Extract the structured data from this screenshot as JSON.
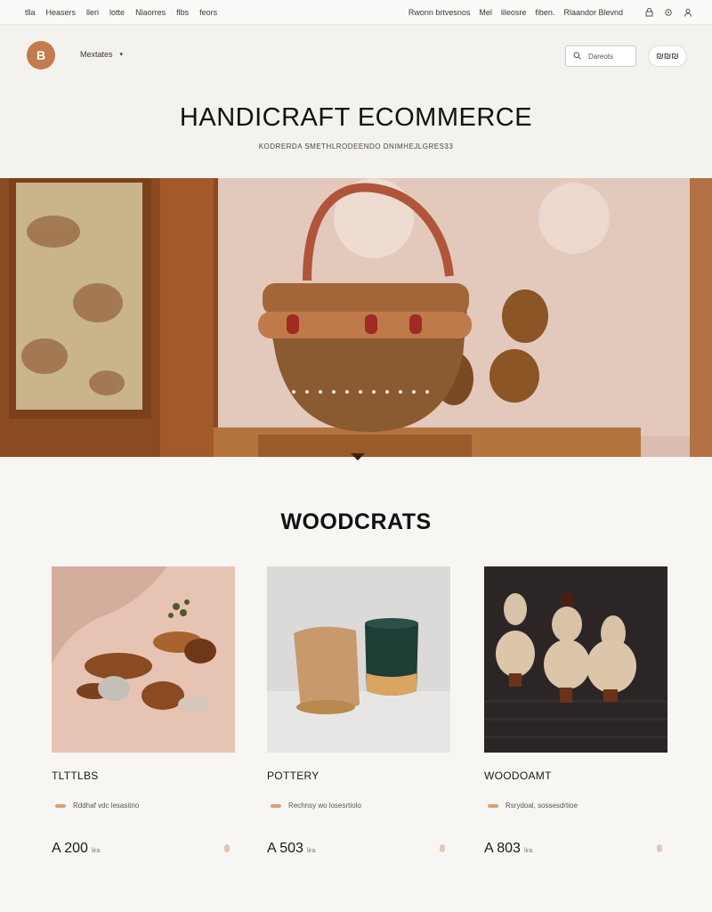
{
  "topbar": {
    "left_links": [
      "tlla",
      "Heasers",
      "lleri",
      "lotte",
      "Nlaorres",
      "flbs",
      "feors"
    ],
    "right_links": [
      "Rwonn brtvesnos",
      "Mel",
      "lileosre",
      "fiben.",
      "Rlaandor Blevnd"
    ],
    "icons": [
      "lock-icon",
      "settings-icon",
      "user-icon"
    ]
  },
  "header": {
    "logo_text": "B",
    "menu_label": "Mextates",
    "search_placeholder": "Dareots",
    "cart_label": "₪₪₪",
    "title": "HANDICRAFT ECOMMERCE",
    "subtitle": "KODRERDA SMETHLRODEENDO DNIMHEJLGRES33"
  },
  "hero": {
    "image_label": "handwoven basket on wooden stand"
  },
  "section": {
    "title": "WOODCRATS"
  },
  "products": [
    {
      "name": "TLTTLBS",
      "desc": "Rddhaf vdc lesasitrio",
      "price": "A 200",
      "unit": "lira"
    },
    {
      "name": "POTTERY",
      "desc": "Rechnsy wo losesrtiolo",
      "price": "A 503",
      "unit": "lira"
    },
    {
      "name": "WOODOAMT",
      "desc": "Rsrydoal, sossesdrtioe",
      "price": "A 803",
      "unit": "lira"
    }
  ],
  "colors": {
    "accent": "#c27b4b",
    "background": "#f7f6f3",
    "text": "#1c1917"
  }
}
